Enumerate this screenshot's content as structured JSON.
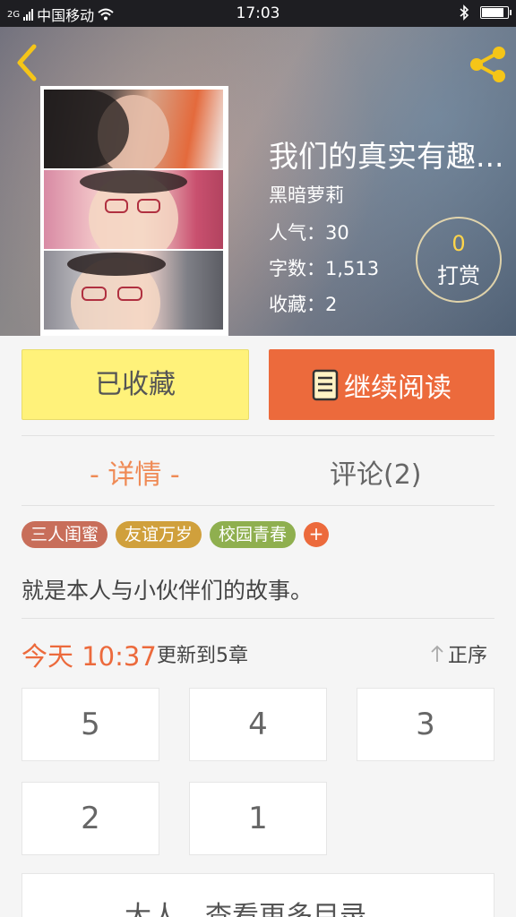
{
  "status_bar": {
    "network": "2G",
    "carrier": "中国移动",
    "time": "17:03",
    "battery_level": 0.9
  },
  "book": {
    "title": "我们的真实有趣...",
    "author": "黑暗萝莉",
    "popularity_label": "人气：",
    "popularity": "30",
    "wordcount_label": "字数：",
    "wordcount": "1,513",
    "favorites_label": "收藏：",
    "favorites": "2",
    "reward_count": "0",
    "reward_label": "打赏",
    "description": "就是本人与小伙伴们的故事。"
  },
  "actions": {
    "collect_label": "已收藏",
    "read_label": "继续阅读"
  },
  "tabs": {
    "details": "- 详情 -",
    "comments": "评论(2)"
  },
  "tags": [
    {
      "label": "三人闺蜜",
      "color": "#c86e5a"
    },
    {
      "label": "友谊万岁",
      "color": "#d0a03c"
    },
    {
      "label": "校园青春",
      "color": "#8faf4f"
    }
  ],
  "tag_add": "+",
  "update": {
    "time": "今天 10:37",
    "info": "更新到5章",
    "sort_label": "正序"
  },
  "chapters": [
    "5",
    "4",
    "3",
    "2",
    "1"
  ],
  "more_label": "大人，查看更多目录",
  "colors": {
    "accent": "#ec6a3c",
    "collect": "#fff27a"
  }
}
